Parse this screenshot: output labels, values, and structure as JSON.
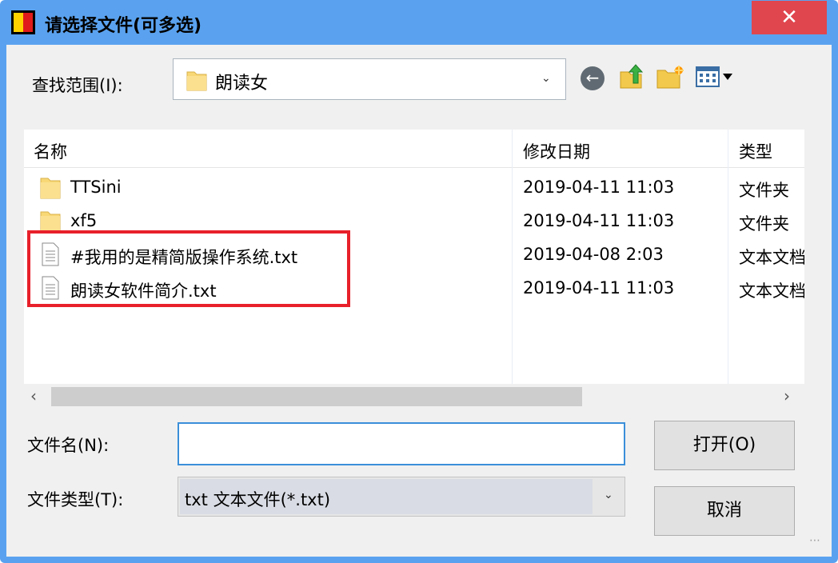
{
  "window": {
    "title": "请选择文件(可多选)",
    "close_glyph": "✕"
  },
  "lookin": {
    "label": "查找范围(I):",
    "value": "朗读女"
  },
  "toolbar": {
    "back_icon": "back-icon",
    "up_icon": "up-folder-icon",
    "new_folder_icon": "new-folder-icon",
    "view_icon": "view-menu-icon"
  },
  "list": {
    "columns": [
      "名称",
      "修改日期",
      "类型"
    ],
    "rows": [
      {
        "name": "TTSini",
        "date": "2019-04-11 11:03",
        "type": "文件夹",
        "icon": "folder-icon"
      },
      {
        "name": "xf5",
        "date": "2019-04-11 11:03",
        "type": "文件夹",
        "icon": "folder-icon"
      },
      {
        "name": "#我用的是精简版操作系统.txt",
        "date": "2019-04-08 2:03",
        "type": "文本文档",
        "icon": "text-file-icon"
      },
      {
        "name": "朗读女软件简介.txt",
        "date": "2019-04-11 11:03",
        "type": "文本文档",
        "icon": "text-file-icon"
      }
    ]
  },
  "filename": {
    "label": "文件名(N):",
    "value": ""
  },
  "filetype": {
    "label": "文件类型(T):",
    "value": "txt 文本文件(*.txt)"
  },
  "buttons": {
    "open": "打开(O)",
    "cancel": "取消"
  },
  "colors": {
    "titlebar": "#5aa2ef",
    "close": "#e0464e",
    "highlight": "#e8202a"
  }
}
